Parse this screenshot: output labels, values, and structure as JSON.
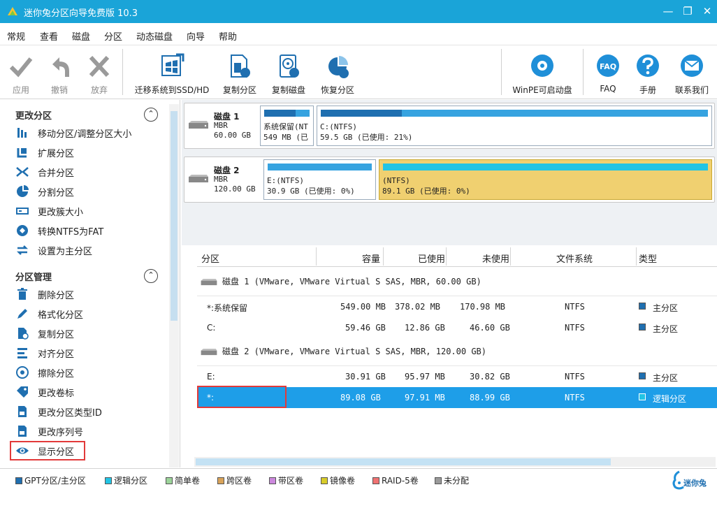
{
  "window": {
    "title": "迷你兔分区向导免费版 10.3"
  },
  "menu": [
    "常规",
    "查看",
    "磁盘",
    "分区",
    "动态磁盘",
    "向导",
    "帮助"
  ],
  "toolbar": {
    "apply": "应用",
    "undo": "撤销",
    "discard": "放弃",
    "migrate": "迁移系统到SSD/HD",
    "copy_partition": "复制分区",
    "copy_disk": "复制磁盘",
    "recover_partition": "恢复分区",
    "winpe": "WinPE可启动盘",
    "faq": "FAQ",
    "manual": "手册",
    "contact": "联系我们",
    "faq_icon_text": "FAQ"
  },
  "left_panel": {
    "section1": {
      "title": "更改分区",
      "items": [
        "移动分区/调整分区大小",
        "扩展分区",
        "合并分区",
        "分割分区",
        "更改簇大小",
        "转换NTFS为FAT",
        "设置为主分区"
      ]
    },
    "section2": {
      "title": "分区管理",
      "items": [
        "删除分区",
        "格式化分区",
        "复制分区",
        "对齐分区",
        "擦除分区",
        "更改卷标",
        "更改分区类型ID",
        "更改序列号",
        "显示分区"
      ]
    }
  },
  "disk_map": {
    "disks": [
      {
        "name": "磁盘 1",
        "type": "MBR",
        "size": "60.00 GB",
        "partitions": [
          {
            "line1": "系统保留(NT",
            "line2": "549 MB (已",
            "used_fraction": 0.69
          },
          {
            "line1": "C:(NTFS)",
            "line2": "59.5 GB (已使用: 21%)",
            "used_fraction": 0.21
          }
        ]
      },
      {
        "name": "磁盘 2",
        "type": "MBR",
        "size": "120.00 GB",
        "partitions": [
          {
            "line1": "E:(NTFS)",
            "line2": "30.9 GB (已使用: 0%)",
            "used_fraction": 0.0
          },
          {
            "line1": "(NTFS)",
            "line2": "89.1 GB (已使用: 0%)",
            "used_fraction": 0.0
          }
        ]
      }
    ]
  },
  "table": {
    "columns": [
      "分区",
      "容量",
      "已使用",
      "未使用",
      "文件系统",
      "类型"
    ],
    "disk1_header": "磁盘 1 (VMware, VMware Virtual S SAS, MBR, 60.00 GB)",
    "disk1_rows": [
      {
        "name": "*:系统保留",
        "capacity": "549.00 MB",
        "used": "378.02 MB",
        "unused": "170.98 MB",
        "fs": "NTFS",
        "type": "主分区"
      },
      {
        "name": "C:",
        "capacity": "59.46 GB",
        "used": "12.86 GB",
        "unused": "46.60 GB",
        "fs": "NTFS",
        "type": "主分区"
      }
    ],
    "disk2_header": "磁盘 2 (VMware, VMware Virtual S SAS, MBR, 120.00 GB)",
    "disk2_rows": [
      {
        "name": "E:",
        "capacity": "30.91 GB",
        "used": "95.97 MB",
        "unused": "30.82 GB",
        "fs": "NTFS",
        "type": "主分区"
      },
      {
        "name": "*:",
        "capacity": "89.08 GB",
        "used": "97.91 MB",
        "unused": "88.99 GB",
        "fs": "NTFS",
        "type": "逻辑分区"
      }
    ]
  },
  "legend": [
    {
      "label": "GPT分区/主分区",
      "color": "#1f6fb0"
    },
    {
      "label": "逻辑分区",
      "color": "#22c4e4"
    },
    {
      "label": "简单卷",
      "color": "#9cd49a"
    },
    {
      "label": "跨区卷",
      "color": "#d9a35a"
    },
    {
      "label": "带区卷",
      "color": "#cc88dd"
    },
    {
      "label": "镜像卷",
      "color": "#d8cc2a"
    },
    {
      "label": "RAID-5卷",
      "color": "#f07272"
    },
    {
      "label": "未分配",
      "color": "#9a9a9a"
    }
  ],
  "brand": {
    "name": "迷你兔"
  },
  "colors": {
    "titlebar": "#1aa4d8",
    "selection": "#1e9ee8",
    "primary": "#1f6fb0",
    "logical": "#22c4e4",
    "highlight": "#e23a3a"
  }
}
